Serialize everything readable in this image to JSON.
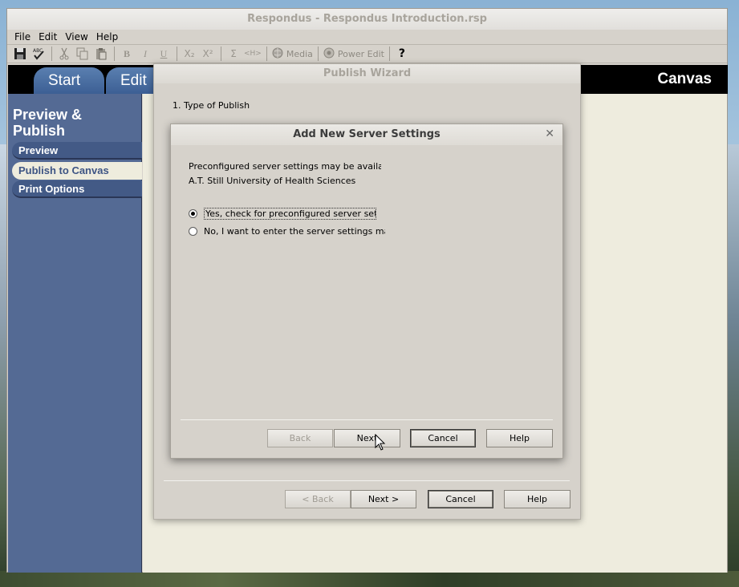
{
  "window": {
    "title": "Respondus - Respondus Introduction.rsp"
  },
  "menu": {
    "items": [
      {
        "label": "File"
      },
      {
        "label": "Edit"
      },
      {
        "label": "View"
      },
      {
        "label": "Help"
      }
    ]
  },
  "toolbar": {
    "bold": "B",
    "italic": "I",
    "underline": "U",
    "subscript": "X₂",
    "superscript": "X²",
    "equation": "Σ",
    "html": "<H>",
    "media_label": "Media",
    "power_edit_label": "Power Edit",
    "help": "?"
  },
  "tabs": {
    "start": "Start",
    "edit": "Edit",
    "lms": "Canvas"
  },
  "sidebar": {
    "title": "Preview & Publish",
    "items": [
      {
        "label": "Preview"
      },
      {
        "label": "Publish to Canvas"
      },
      {
        "label": "Print Options"
      }
    ]
  },
  "wizard": {
    "title": "Publish Wizard",
    "step": "1.  Type of Publish",
    "back": "< Back",
    "next": "Next >",
    "cancel": "Cancel",
    "help": "Help"
  },
  "dialog": {
    "title": "Add New Server Settings",
    "line1": "Preconfigured server settings may be availabl",
    "line2": "A.T. Still University of Health Sciences",
    "option_yes": "Yes, check for preconfigured server setti",
    "option_no": "No, I want to enter the server settings man",
    "selected": "yes",
    "back": "Back",
    "next": "Next",
    "cancel": "Cancel",
    "help": "Help"
  }
}
